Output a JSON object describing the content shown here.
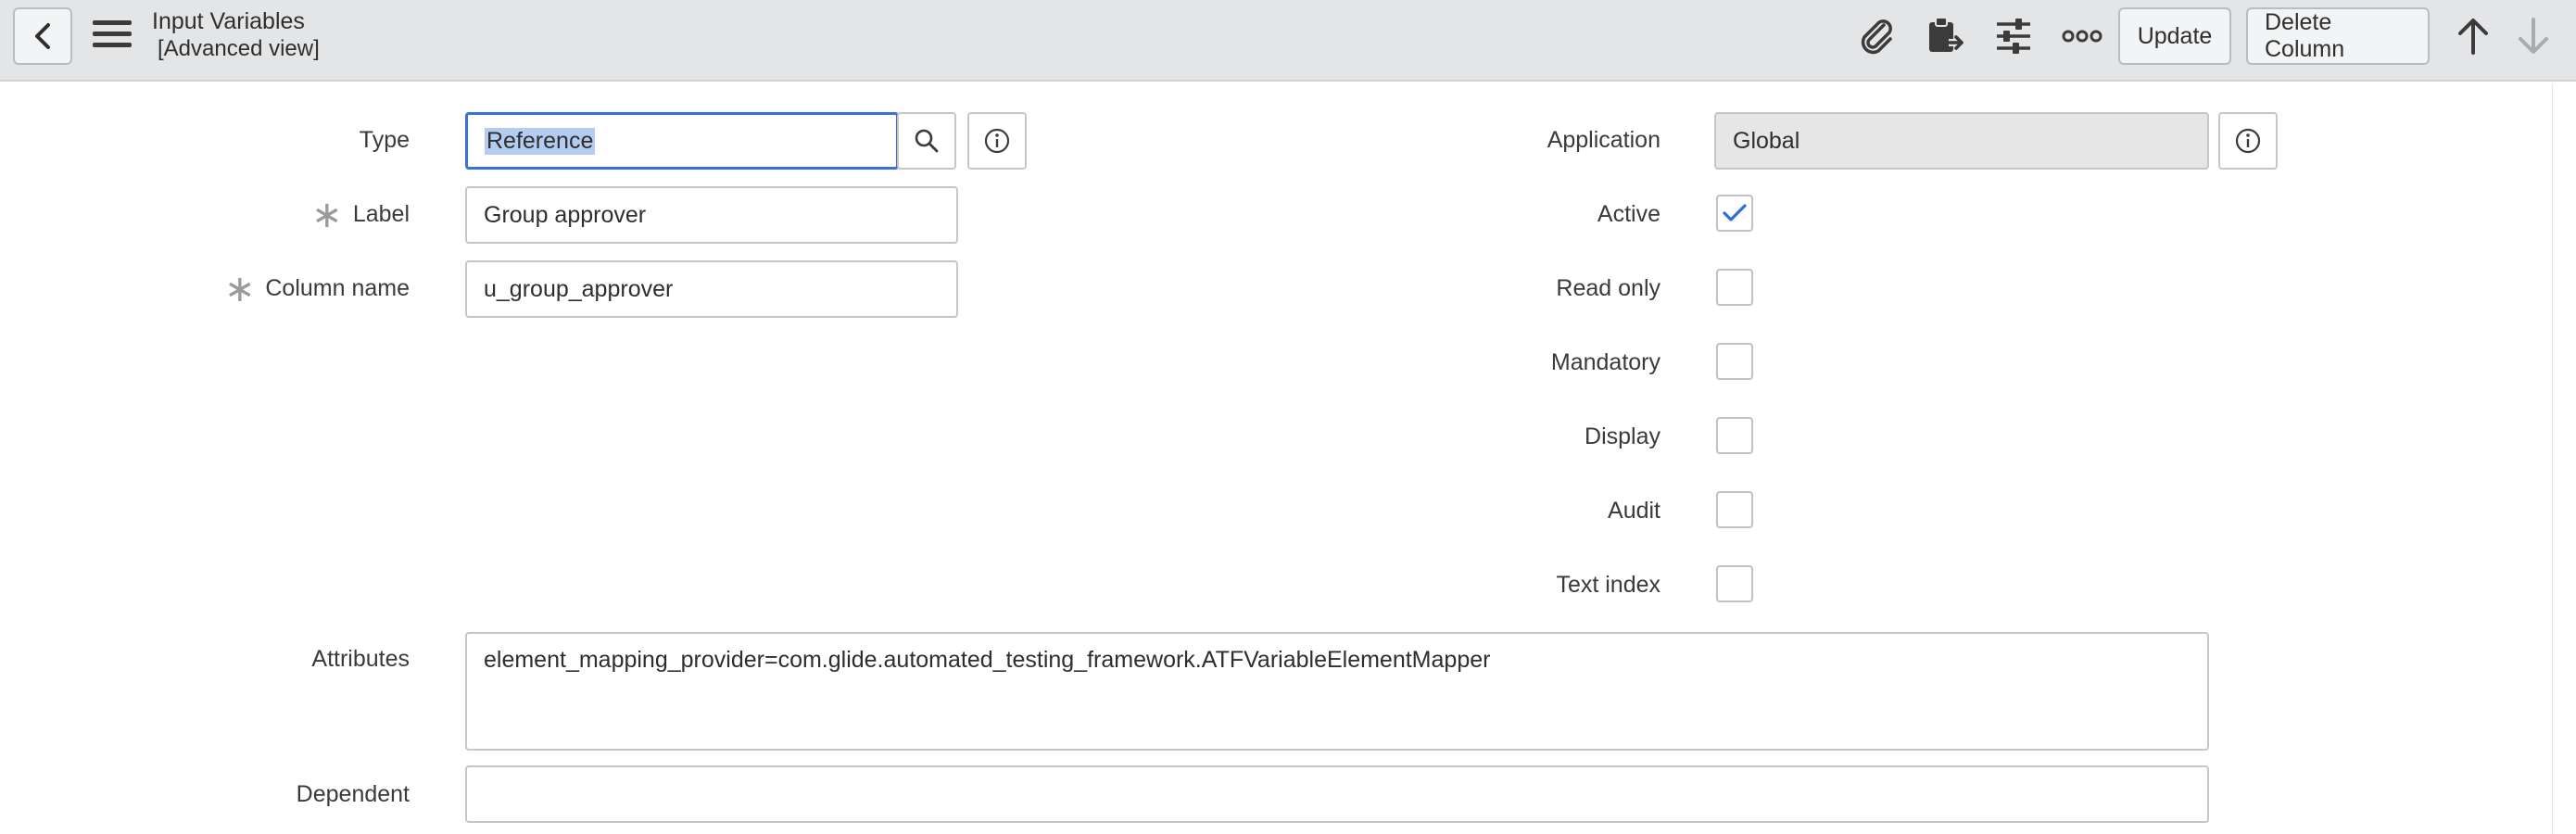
{
  "header": {
    "title": "Input Variables",
    "subtitle": "[Advanced view]",
    "update_label": "Update",
    "delete_label": "Delete Column"
  },
  "form": {
    "type": {
      "label": "Type",
      "value": "Reference"
    },
    "label": {
      "label": "Label",
      "value": "Group approver",
      "required": true
    },
    "column_name": {
      "label": "Column name",
      "value": "u_group_approver",
      "required": true
    },
    "application": {
      "label": "Application",
      "value": "Global"
    },
    "active": {
      "label": "Active",
      "checked": true
    },
    "read_only": {
      "label": "Read only",
      "checked": false
    },
    "mandatory": {
      "label": "Mandatory",
      "checked": false
    },
    "display": {
      "label": "Display",
      "checked": false
    },
    "audit": {
      "label": "Audit",
      "checked": false
    },
    "text_index": {
      "label": "Text index",
      "checked": false
    },
    "attributes": {
      "label": "Attributes",
      "value": "element_mapping_provider=com.glide.automated_testing_framework.ATFVariableElementMapper"
    },
    "dependent": {
      "label": "Dependent",
      "value": ""
    }
  },
  "icons": {
    "back": "chevron-left-icon",
    "menu": "hamburger-icon",
    "attachment": "paperclip-icon",
    "clipboard": "clipboard-icon",
    "settings": "sliders-icon",
    "more": "more-icon",
    "up": "arrow-up-icon",
    "down": "arrow-down-icon",
    "search": "search-icon",
    "info": "info-icon"
  },
  "colors": {
    "header_bg": "#e4e5e7",
    "focus_border": "#3d6fd8",
    "selection": "#b4ccef",
    "check": "#2a6fd6"
  }
}
